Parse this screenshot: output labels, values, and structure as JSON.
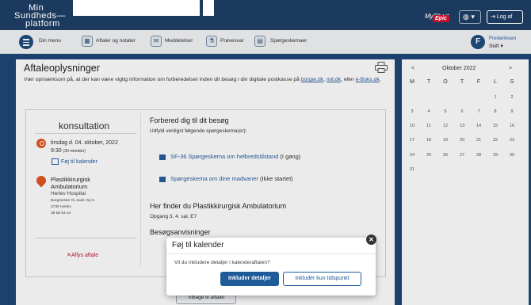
{
  "header": {
    "logo_line1": "Min",
    "logo_line2": "Sundheds—",
    "logo_line3": "platform",
    "mychart_text": "MyChart",
    "epic_text": "Epic",
    "globe_caret": "▾",
    "logout_label": "Log af"
  },
  "nav": {
    "menu_label": "Din menu",
    "items": [
      {
        "label": "Aftaler og notater",
        "icon": "calendar-icon"
      },
      {
        "label": "Meddelelser",
        "icon": "envelope-icon"
      },
      {
        "label": "Prøvesvar",
        "icon": "flask-icon"
      },
      {
        "label": "Spørgeskemaer",
        "icon": "clipboard-icon"
      }
    ],
    "user_initial": "F",
    "user_name": "Frederiksen",
    "user_role": "Skift ▾"
  },
  "page": {
    "title": "Aftaleoplysninger",
    "intro_before": "Vær opmærksom på, at der kan være vigtig information om forberedelser inden dit besøg i din digitale postkasse på ",
    "intro_link1": "borger.dk",
    "intro_mid1": ", ",
    "intro_link2": "mit.dk",
    "intro_mid2": ", eller ",
    "intro_link3": "e-Boks.dk",
    "intro_end": "."
  },
  "visit": {
    "type": "konsultation",
    "date": "tirsdag d. 04. oktober, 2022",
    "time": "9:30",
    "duration": "(30 minutter)",
    "add_calendar": "Føj til kalender",
    "department": "Plastikkirurgisk Ambulatorium",
    "hospital": "Herlev Hospital",
    "address_line1": "Borgmester Ib Juuls Vej 5",
    "address_line2": "2730 Herlev",
    "phone": "38 68 54 44",
    "cancel_label": "Aflys aftale"
  },
  "prep": {
    "title": "Forbered dig til dit besøg",
    "subtitle": "Udfyld venligst følgende spørgeskema(er):",
    "questionnaires": [
      {
        "name": "SF-36 Spørgeskema om helbredstilstand",
        "status": "(I gang)"
      },
      {
        "name": "Spørgeskema om dine madvaner",
        "status": "(Ikke startet)"
      }
    ],
    "find_title": "Her finder du Plastikkirurgisk Ambulatorium",
    "find_sub": "Opgang 3, 4. sal, E7",
    "visit_instructions": "Besøgsanvisninger"
  },
  "back_label": "Tilbage til aftaler",
  "calendar": {
    "prev": "<",
    "next": ">",
    "month": "Oktober 2022",
    "weekdays": [
      "M",
      "T",
      "O",
      "T",
      "F",
      "L",
      "S"
    ],
    "weeks": [
      [
        "",
        "",
        "",
        "",
        "",
        "1",
        "2"
      ],
      [
        "3",
        "4",
        "5",
        "6",
        "7",
        "8",
        "9"
      ],
      [
        "10",
        "11",
        "12",
        "13",
        "14",
        "15",
        "16"
      ],
      [
        "17",
        "18",
        "19",
        "20",
        "21",
        "22",
        "23"
      ],
      [
        "24",
        "25",
        "26",
        "27",
        "28",
        "29",
        "30"
      ],
      [
        "31",
        "",
        "",
        "",
        "",
        "",
        ""
      ]
    ]
  },
  "modal": {
    "title": "Føj til kalender",
    "text": "Vil du inkludere detaljer i kalenderaftalen?",
    "primary": "Inkluder detaljer",
    "secondary": "Inkluder kun tidspunkt",
    "close": "✕"
  },
  "colors": {
    "header_bg": "#1c3a5e",
    "main_bg": "#1e4778",
    "accent": "#1f5a99",
    "link": "#2a5d9f",
    "orange": "#e2561f",
    "danger": "#c8102e"
  }
}
